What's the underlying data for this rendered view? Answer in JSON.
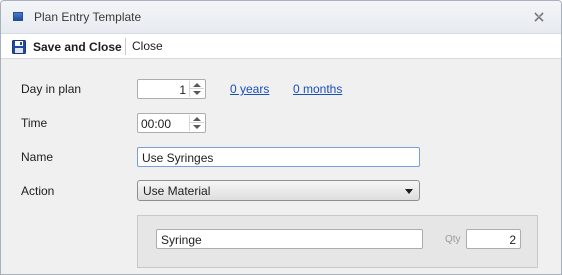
{
  "window": {
    "title": "Plan Entry Template"
  },
  "toolbar": {
    "save_label": "Save and Close",
    "close_label": "Close"
  },
  "form": {
    "day_label": "Day in plan",
    "day_value": "1",
    "years_link": "0 years",
    "months_link": "0 months",
    "time_label": "Time",
    "time_value": "00:00",
    "name_label": "Name",
    "name_value": "Use Syringes",
    "action_label": "Action",
    "action_value": "Use Material"
  },
  "material": {
    "item_value": "Syringe",
    "qty_label": "Qty",
    "qty_value": "2"
  },
  "icons": {
    "app": "app-window-icon",
    "close": "close-x-icon",
    "save": "floppy-disk-icon"
  },
  "colors": {
    "link": "#1a4fb8",
    "focus_border": "#7a9fd1",
    "save_icon": "#1f4b9f"
  }
}
